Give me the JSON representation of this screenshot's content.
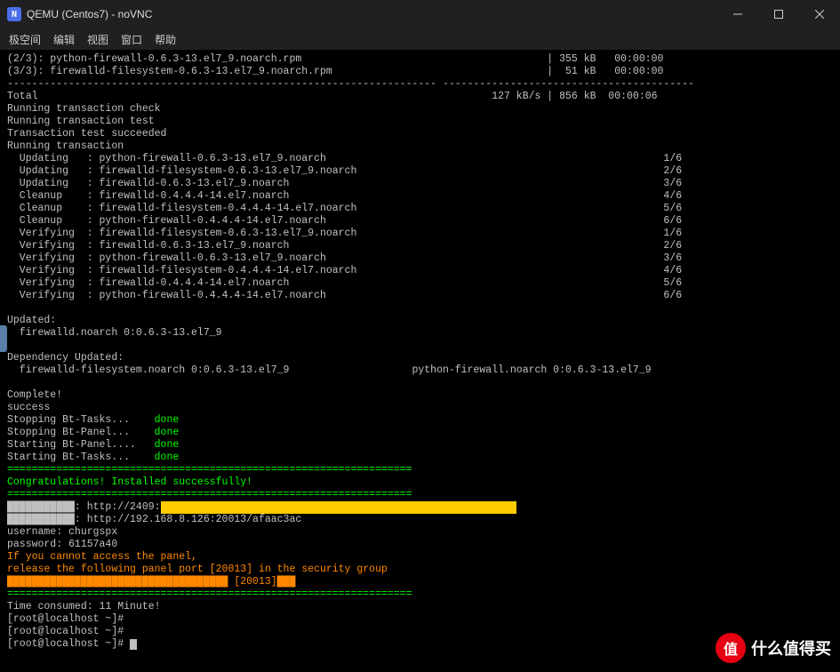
{
  "window": {
    "icon_letter": "N",
    "title": "QEMU (Centos7) - noVNC"
  },
  "menubar": {
    "items": [
      "极空间",
      "编辑",
      "视图",
      "窗口",
      "帮助"
    ]
  },
  "terminal": {
    "download_23": "(2/3): python-firewall-0.6.3-13.el7_9.noarch.rpm                                        | 355 kB   00:00:00",
    "download_33": "(3/3): firewalld-filesystem-0.6.3-13.el7_9.noarch.rpm                                   |  51 kB   00:00:00",
    "dashes": "---------------------------------------------------------------------- -----------------------------------------",
    "total": "Total                                                                          127 kB/s | 856 kB  00:00:06",
    "rtc": "Running transaction check",
    "rtt": "Running transaction test",
    "tts": "Transaction test succeeded",
    "rt": "Running transaction",
    "u1": "  Updating   : python-firewall-0.6.3-13.el7_9.noarch                                                       1/6",
    "u2": "  Updating   : firewalld-filesystem-0.6.3-13.el7_9.noarch                                                  2/6",
    "u3": "  Updating   : firewalld-0.6.3-13.el7_9.noarch                                                             3/6",
    "c1": "  Cleanup    : firewalld-0.4.4.4-14.el7.noarch                                                             4/6",
    "c2": "  Cleanup    : firewalld-filesystem-0.4.4.4-14.el7.noarch                                                  5/6",
    "c3": "  Cleanup    : python-firewall-0.4.4.4-14.el7.noarch                                                       6/6",
    "v1": "  Verifying  : firewalld-filesystem-0.6.3-13.el7_9.noarch                                                  1/6",
    "v2": "  Verifying  : firewalld-0.6.3-13.el7_9.noarch                                                             2/6",
    "v3": "  Verifying  : python-firewall-0.6.3-13.el7_9.noarch                                                       3/6",
    "v4": "  Verifying  : firewalld-filesystem-0.4.4.4-14.el7.noarch                                                  4/6",
    "v5": "  Verifying  : firewalld-0.4.4.4-14.el7.noarch                                                             5/6",
    "v6": "  Verifying  : python-firewall-0.4.4.4-14.el7.noarch                                                       6/6",
    "updated": "Updated:",
    "updated_pkg": "  firewalld.noarch 0:0.6.3-13.el7_9",
    "dep_updated": "Dependency Updated:",
    "dep_line": "  firewalld-filesystem.noarch 0:0.6.3-13.el7_9                    python-firewall.noarch 0:0.6.3-13.el7_9",
    "complete": "Complete!",
    "success": "success",
    "stop_tasks": "Stopping Bt-Tasks...    ",
    "stop_panel": "Stopping Bt-Panel...    ",
    "start_panel": "Starting Bt-Panel....   ",
    "start_tasks": "Starting Bt-Tasks...    ",
    "done": "done",
    "eq_line": "==================================================================",
    "congrats": "Congratulations! Installed successfully!",
    "blocks_pre": "███████████: http://2409:",
    "redacted": "                                                          ",
    "url_lan": "███████████: http://192.168.8.126:20013/afaac3ac",
    "username": "username: churgspx",
    "password": "password: 61157a40",
    "warn1": "If you cannot access the panel,",
    "warn2": "release the following panel port [20013] in the security group",
    "warn3": "████████████████████████████████████ [20013]███",
    "time": "Time consumed: 11 Minute!",
    "prompt": "[root@localhost ~]# "
  },
  "watermark": {
    "circle": "值",
    "text": "什么值得买"
  }
}
